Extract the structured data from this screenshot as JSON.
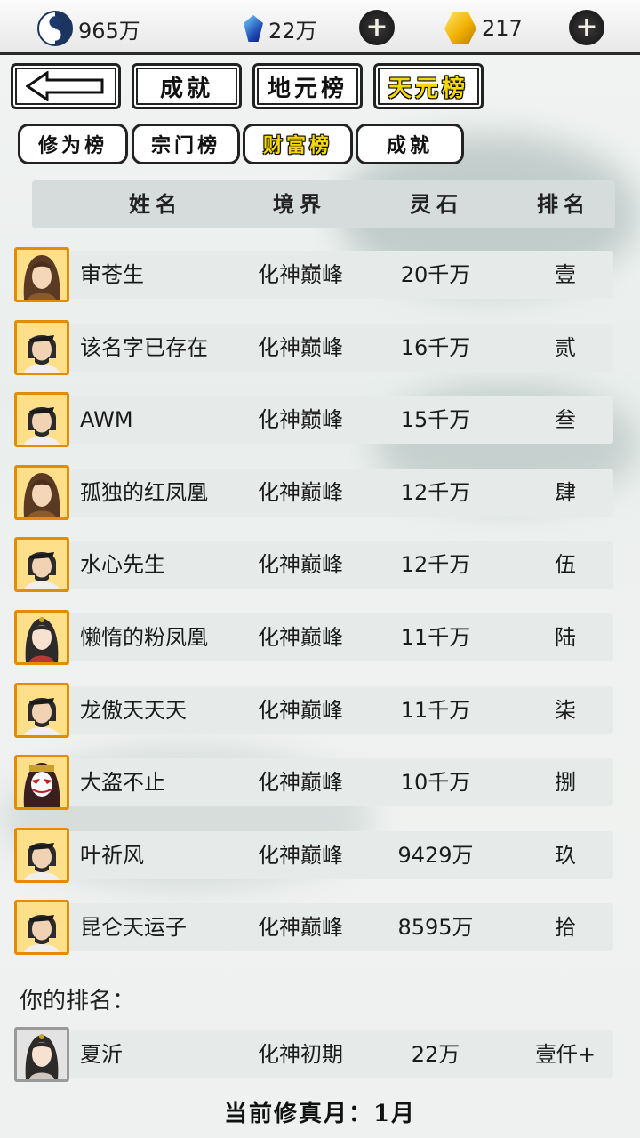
{
  "resources": {
    "taiji_value": "965万",
    "blue_gem_value": "22万",
    "gold_value": "217",
    "plus_symbol": "+"
  },
  "tabs": {
    "top": [
      "成就",
      "地元榜",
      "天元榜"
    ],
    "top_active": "天元榜",
    "sub": [
      "修为榜",
      "宗门榜",
      "财富榜",
      "成就"
    ],
    "sub_active": "财富榜"
  },
  "columns": [
    "姓名",
    "境界",
    "灵石",
    "排名"
  ],
  "rows": [
    {
      "name": "审苍生",
      "realm": "化神巅峰",
      "stones": "20千万",
      "rank": "壹",
      "avatar": "portrait-warrior"
    },
    {
      "name": "该名字已存在",
      "realm": "化神巅峰",
      "stones": "16千万",
      "rank": "贰",
      "avatar": "portrait-swordsman"
    },
    {
      "name": "AWM",
      "realm": "化神巅峰",
      "stones": "15千万",
      "rank": "叁",
      "avatar": "portrait-swordsman"
    },
    {
      "name": "孤独的红凤凰",
      "realm": "化神巅峰",
      "stones": "12千万",
      "rank": "肆",
      "avatar": "portrait-warrior"
    },
    {
      "name": "水心先生",
      "realm": "化神巅峰",
      "stones": "12千万",
      "rank": "伍",
      "avatar": "portrait-swordsman"
    },
    {
      "name": "懒惰的粉凤凰",
      "realm": "化神巅峰",
      "stones": "11千万",
      "rank": "陆",
      "avatar": "portrait-lady"
    },
    {
      "name": "龙傲天天天",
      "realm": "化神巅峰",
      "stones": "11千万",
      "rank": "柒",
      "avatar": "portrait-swordsman"
    },
    {
      "name": "大盗不止",
      "realm": "化神巅峰",
      "stones": "10千万",
      "rank": "捌",
      "avatar": "portrait-masked"
    },
    {
      "name": "叶祈风",
      "realm": "化神巅峰",
      "stones": "9429万",
      "rank": "玖",
      "avatar": "portrait-swordsman"
    },
    {
      "name": "昆仑天运子",
      "realm": "化神巅峰",
      "stones": "8595万",
      "rank": "拾",
      "avatar": "portrait-swordsman"
    }
  ],
  "my_rank": {
    "label": "你的排名：",
    "name": "夏沂",
    "realm": "化神初期",
    "stones": "22万",
    "rank": "壹仟+",
    "avatar": "portrait-lady"
  },
  "footer": "当前修真月：1月",
  "colors": {
    "active_tab_text": "#f5d800",
    "avatar_border": "#e58b00",
    "row_bg": "#e6ebea"
  }
}
